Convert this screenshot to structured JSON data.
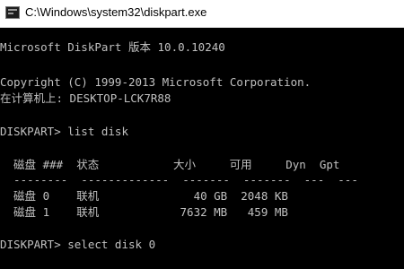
{
  "window": {
    "title": "C:\\Windows\\system32\\diskpart.exe",
    "icon": "console-icon"
  },
  "console": {
    "text_color": "#c0c0c0",
    "background": "#000000",
    "lines": {
      "version": "Microsoft DiskPart 版本 10.0.10240",
      "copyright": "Copyright (C) 1999-2013 Microsoft Corporation.",
      "computer": "在计算机上: DESKTOP-LCK7R88",
      "cmd_list": "DISKPART> list disk",
      "table_header": "  磁盘 ###  状态           大小     可用     Dyn  Gpt",
      "table_rule": "  --------  -------------  -------  -------  ---  ---",
      "row_disk0": "  磁盘 0    联机              40 GB  2048 KB",
      "row_disk1": "  磁盘 1    联机            7632 MB   459 MB",
      "cmd_select": "DISKPART> select disk 0"
    }
  }
}
